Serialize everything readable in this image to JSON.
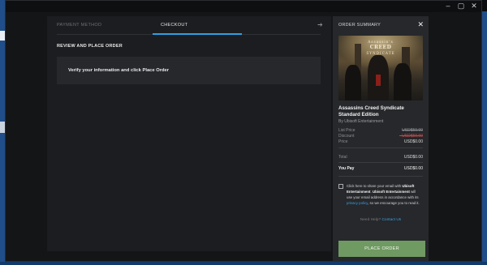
{
  "window": {
    "controls": {
      "minimize": "–",
      "maximize": "▢",
      "close": "✕"
    }
  },
  "steps": {
    "payment_method": "PAYMENT METHOD",
    "checkout": "CHECKOUT",
    "next_arrow": "➔"
  },
  "review": {
    "title": "REVIEW AND PLACE ORDER",
    "info": "Verify your information and click Place Order"
  },
  "summary": {
    "header": "ORDER SUMMARY",
    "close": "✕",
    "cover": {
      "logo_line1": "Assassin's",
      "logo_line2": "CREED",
      "logo_line3": "SYNDICATE"
    },
    "product_title": "Assassins Creed Syndicate Standard Edition",
    "publisher": "By Ubisoft Entertainment",
    "rows": {
      "list_price": {
        "label": "List Price",
        "value": "USD$59.99"
      },
      "discount": {
        "label": "Discount",
        "value": "- USD$59.99"
      },
      "price": {
        "label": "Price",
        "value": "USD$0.00"
      },
      "total": {
        "label": "Total",
        "value": "USD$0.00"
      },
      "you_pay": {
        "label": "You Pay",
        "value": "USD$0.00"
      }
    },
    "consent": {
      "part1": "Click here to share your email with ",
      "company1": "Ubisoft Entertainment",
      "part2": ". ",
      "company2": "Ubisoft Entertainment",
      "part3": " will use your email address in accordance with its ",
      "privacy_link": "privacy policy",
      "part4": ", so we encourage you to read it."
    },
    "help": {
      "question": "Need Help? ",
      "link": "Contact Us"
    },
    "place_order": "PLACE ORDER"
  },
  "colors": {
    "accent": "#2f9fe5",
    "place_order_button": "#6f9a62",
    "discount": "#c24a4a"
  }
}
